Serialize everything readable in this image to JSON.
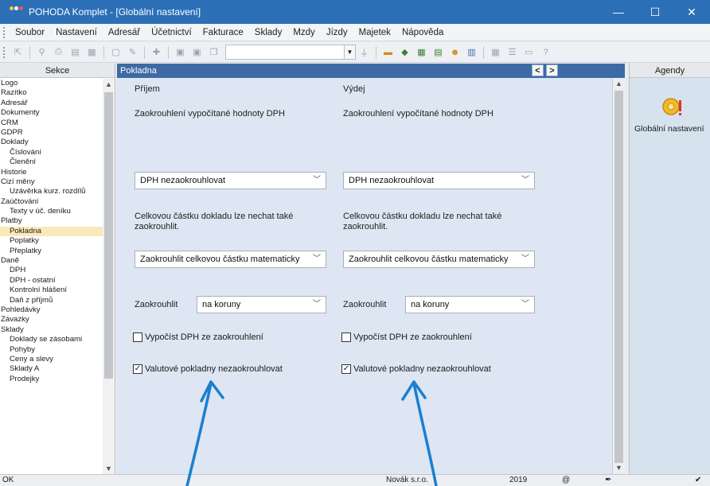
{
  "window": {
    "title": "POHODA Komplet - [Globální nastavení]",
    "controls": {
      "minimize": "—",
      "maximize": "☐",
      "close": "✕"
    }
  },
  "menu": [
    "Soubor",
    "Nastavení",
    "Adresář",
    "Účetnictví",
    "Fakturace",
    "Sklady",
    "Mzdy",
    "Jízdy",
    "Majetek",
    "Nápověda"
  ],
  "sidebar": {
    "header": "Sekce",
    "items": [
      {
        "label": "Logo",
        "sub": false
      },
      {
        "label": "Razítko",
        "sub": false
      },
      {
        "label": "Adresář",
        "sub": false
      },
      {
        "label": "Dokumenty",
        "sub": false
      },
      {
        "label": "CRM",
        "sub": false
      },
      {
        "label": "GDPR",
        "sub": false
      },
      {
        "label": "Doklady",
        "sub": false
      },
      {
        "label": "Číslování",
        "sub": true
      },
      {
        "label": "Členění",
        "sub": true
      },
      {
        "label": "Historie",
        "sub": false
      },
      {
        "label": "Cizí měny",
        "sub": false
      },
      {
        "label": "Uzávěrka kurz. rozdílů",
        "sub": true
      },
      {
        "label": "Zaúčtování",
        "sub": false
      },
      {
        "label": "Texty v úč. deníku",
        "sub": true
      },
      {
        "label": "Platby",
        "sub": false
      },
      {
        "label": "Pokladna",
        "sub": true,
        "selected": true
      },
      {
        "label": "Poplatky",
        "sub": true
      },
      {
        "label": "Přeplatky",
        "sub": true
      },
      {
        "label": "Daně",
        "sub": false
      },
      {
        "label": "DPH",
        "sub": true
      },
      {
        "label": "DPH - ostatní",
        "sub": true
      },
      {
        "label": "Kontrolní hlášení",
        "sub": true
      },
      {
        "label": "Daň z příjmů",
        "sub": true
      },
      {
        "label": "Pohledávky",
        "sub": false
      },
      {
        "label": "Závazky",
        "sub": false
      },
      {
        "label": "Sklady",
        "sub": false
      },
      {
        "label": "Doklady se zásobami",
        "sub": true
      },
      {
        "label": "Pohyby",
        "sub": true
      },
      {
        "label": "Ceny a slevy",
        "sub": true
      },
      {
        "label": "Sklady A",
        "sub": true
      },
      {
        "label": "Prodejky",
        "sub": true
      }
    ]
  },
  "panel": {
    "title": "Pokladna",
    "prev": "<",
    "next": ">",
    "columns": [
      {
        "heading": "Příjem",
        "vat_rounding_label": "Zaokrouhlení vypočítané hodnoty DPH",
        "vat_rounding_value": "DPH nezaokrouhlovat",
        "total_note": "Celkovou částku dokladu lze nechat také zaokrouhlit.",
        "total_rounding_value": "Zaokrouhlit celkovou částku matematicky",
        "round_label": "Zaokrouhlit",
        "round_value": "na koruny",
        "calc_vat_label": "Vypočíst DPH ze zaokrouhlení",
        "calc_vat_checked": false,
        "currency_label": "Valutové pokladny nezaokrouhlovat",
        "currency_checked": true
      },
      {
        "heading": "Výdej",
        "vat_rounding_label": "Zaokrouhlení vypočítané hodnoty DPH",
        "vat_rounding_value": "DPH nezaokrouhlovat",
        "total_note": "Celkovou částku dokladu lze nechat také zaokrouhlit.",
        "total_rounding_value": "Zaokrouhlit celkovou částku matematicky",
        "round_label": "Zaokrouhlit",
        "round_value": "na koruny",
        "calc_vat_label": "Vypočíst DPH ze zaokrouhlení",
        "calc_vat_checked": false,
        "currency_label": "Valutové pokladny nezaokrouhlovat",
        "currency_checked": true
      }
    ]
  },
  "agendy": {
    "header": "Agendy",
    "item": "Globální nastavení"
  },
  "status": {
    "left": "OK",
    "company": "Novák s.r.o.",
    "year": "2019"
  },
  "colors": {
    "titlebar": "#2b6fb7",
    "panel_header": "#3d6aa5",
    "annotation_arrow": "#1a7fd1",
    "selection": "#fbeab9"
  }
}
